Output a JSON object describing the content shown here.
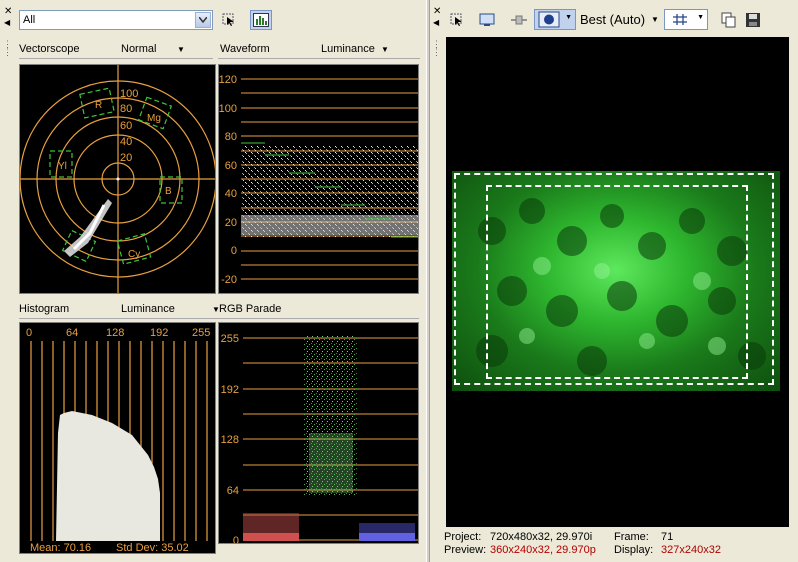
{
  "left_toolbar": {
    "channel_select": "All",
    "select_icon": "pointer-select-icon",
    "scope_icon": "video-scopes-icon"
  },
  "vectorscope": {
    "title": "Vectorscope",
    "mode": "Normal",
    "rings": [
      "100",
      "80",
      "60",
      "40",
      "20"
    ],
    "targets": [
      "R",
      "Mg",
      "Yl",
      "B",
      "Cy"
    ]
  },
  "waveform": {
    "title": "Waveform",
    "mode": "Luminance",
    "ticks": [
      "120",
      "100",
      "80",
      "60",
      "40",
      "20",
      "0",
      "-20"
    ]
  },
  "histogram": {
    "title": "Histogram",
    "mode": "Luminance",
    "ticks": [
      "0",
      "64",
      "128",
      "192",
      "255"
    ],
    "mean": "Mean: 70.16",
    "stddev": "Std Dev: 35.02"
  },
  "parade": {
    "title": "RGB Parade",
    "ticks": [
      "255",
      "192",
      "128",
      "64",
      "0"
    ]
  },
  "right_toolbar": {
    "quality": "Best (Auto)"
  },
  "footer": {
    "project_label": "Project:",
    "project_value": "720x480x32, 29.970i",
    "preview_label": "Preview:",
    "preview_value": "360x240x32, 29.970p",
    "frame_label": "Frame:",
    "frame_value": "71",
    "display_label": "Display:",
    "display_value": "327x240x32"
  },
  "colors": {
    "graticule": "#e8a040",
    "safe_area": "#ffffff",
    "preview_tint": "#2fd22f",
    "status_red": "#b00000"
  }
}
